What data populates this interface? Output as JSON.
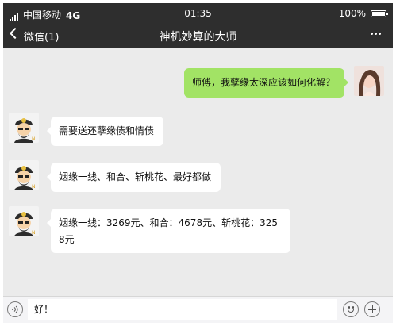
{
  "status_bar": {
    "carrier": "中国移动",
    "network": "4G",
    "time": "01:35",
    "battery_percent": "100%",
    "battery_level": 1.0
  },
  "nav": {
    "back_label": "微信(1)",
    "title": "神机妙算的大师",
    "more_label": "…"
  },
  "messages": [
    {
      "side": "right",
      "sender": "user",
      "text": "师傅，我孽缘太深应该如何化解？"
    },
    {
      "side": "left",
      "sender": "master",
      "text": "需要送还孽缘债和情债"
    },
    {
      "side": "left",
      "sender": "master",
      "text": "姻缘一线、和合、斩桃花、最好都做"
    },
    {
      "side": "left",
      "sender": "master",
      "text": "姻缘一线：3269元、和合：4678元、斩桃花：3258元"
    }
  ],
  "input_bar": {
    "voice_icon": "voice-icon",
    "input_value": "好！",
    "emoji_icon": "emoji-icon",
    "plus_icon": "plus-icon"
  },
  "colors": {
    "nav_bg": "#2e2e2e",
    "chat_bg": "#ebebeb",
    "outgoing_bubble": "#a2e365",
    "incoming_bubble": "#ffffff"
  }
}
